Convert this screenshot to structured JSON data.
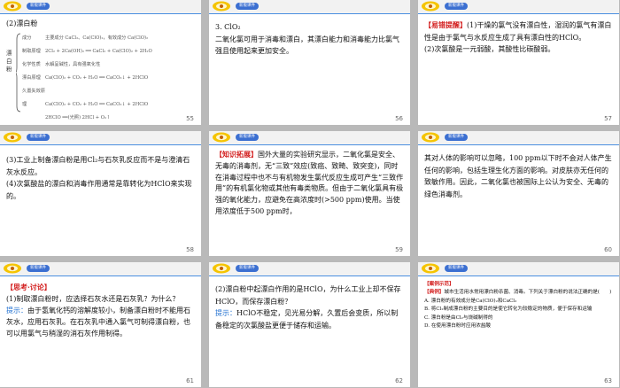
{
  "badge_label": "新版课件",
  "slides": [
    {
      "num": "55",
      "title": "(2)漂白粉",
      "diagram": {
        "root": "漂白粉",
        "rows": [
          {
            "label": "成分",
            "text": "主要成分 CaCl₂、Ca(ClO)₂，有效成分 Ca(ClO)₂"
          },
          {
            "label": "制取原理",
            "text": "2Cl₂ + 2Ca(OH)₂ ══ CaCl₂ + Ca(ClO)₂ + 2H₂O"
          },
          {
            "label": "化学性质",
            "text": "水解呈碱性，具有强氧化性"
          },
          {
            "label": "漂白原理",
            "text": "Ca(ClO)₂ + CO₂ + H₂O ══ CaCO₃↓ + 2HClO"
          },
          {
            "label": "久置失效原理",
            "text": "Ca(ClO)₂ + CO₂ + H₂O ══ CaCO₃↓ + 2HClO"
          },
          {
            "label": "",
            "text": "2HClO ══(光照) 2HCl + O₂↑"
          }
        ]
      }
    },
    {
      "num": "56",
      "title": "3. ClO₂",
      "lines": [
        "二氧化氯可用于消毒和漂白，其漂白能力和消毒能力比氯气强且使用起来更加安全。"
      ]
    },
    {
      "num": "57",
      "tag": "【易错提醒】",
      "lines": [
        "(1)干燥的氯气没有漂白性，湿润的氯气有漂白性是由于氯气与水反应生成了具有漂白性的HClO。",
        "(2)次氯酸是一元弱酸，其酸性比碳酸弱。"
      ]
    },
    {
      "num": "58",
      "lines": [
        "(3)工业上制备漂白粉是用Cl₂与石灰乳反应而不是与澄清石灰水反应。",
        "(4)次氯酸盐的漂白和消毒作用通常是靠转化为HClO来实现的。"
      ]
    },
    {
      "num": "59",
      "tag": "【知识拓展】",
      "lines": [
        "国外大量的实验研究显示，二氧化氯是安全、无毒的消毒剂，无“三致”效应(致癌、致畸、致突变)，同时在消毒过程中也不与有机物发生氯代反应生成可产生“三致作用”的有机氯化物或其他有毒类物质。但由于二氧化氯具有极强的氧化能力，应避免在高浓度时(>500 ppm)使用。当使用浓度低于500 ppm时，"
      ]
    },
    {
      "num": "60",
      "lines": [
        "其对人体的影响可以忽略，100 ppm以下时不会对人体产生任何的影响，包括生理生化方面的影响。对皮肤亦无任何的致敏作用。因此，二氧化氯也被国际上公认为安全、无毒的绿色消毒剂。"
      ]
    },
    {
      "num": "61",
      "tag": "【思考·讨论】",
      "lines": [
        "(1)制取漂白粉时，应选择石灰水还是石灰乳？为什么？"
      ],
      "hint_label": "提示：",
      "hint": "由于氢氧化钙的溶解度较小，制备漂白粉时不能用石灰水，应用石灰乳。在石灰乳中通入氯气可制得漂白粉，也可以用氯气与稍湿的消石灰作用制得。"
    },
    {
      "num": "62",
      "lines": [
        "(2)漂白粉中起漂白作用的是HClO，为什么工业上却不保存HClO，而保存漂白粉？"
      ],
      "hint_label": "提示：",
      "hint": "HClO不稳定，见光易分解，久置后会变质，所以制备稳定的次氯酸盐更便于储存和运输。"
    },
    {
      "num": "63",
      "tag": "【案例示范】",
      "example_label": "【典例】",
      "question": "城市生活用水常用漂白粉杀菌、消毒。下列关于漂白粉的说法正确的是(　　)",
      "options": [
        "A. 漂白粉的有效成分是Ca(ClO)₂和CaCl₂",
        "B. 将Cl₂制成漂白粉的主要目的是使它转化为较稳定的物质，便于保存和运输",
        "C. 漂白粉是由Cl₂与烧碱制得的",
        "D. 在使用漂白粉时应用浓盐酸"
      ]
    }
  ]
}
